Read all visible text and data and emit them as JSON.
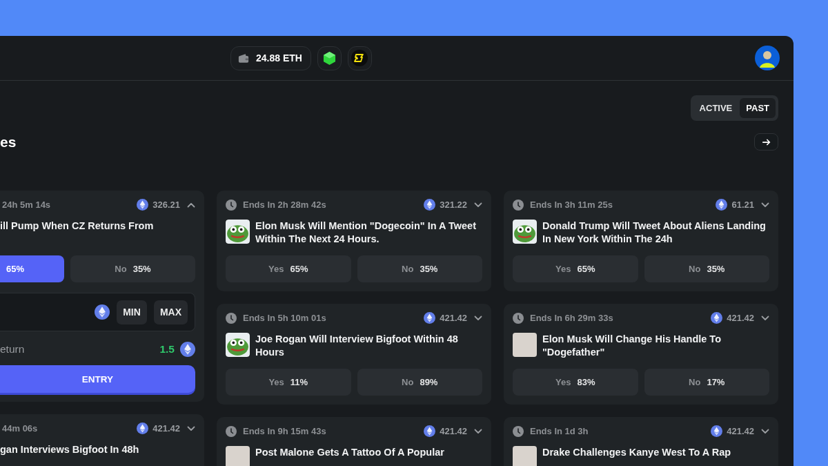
{
  "header": {
    "balance": "24.88 ETH"
  },
  "filter_tabs": [
    {
      "label": "ACTIVE",
      "selected": false
    },
    {
      "label": "PAST",
      "selected": true
    }
  ],
  "section": {
    "title": "es"
  },
  "columns": [
    {
      "cards": [
        {
          "clock": false,
          "ends": "24h 5m 14s",
          "amount": "326.21",
          "expanded": true,
          "question": "ill Pump When CZ Returns From",
          "options": [
            {
              "pct": "65%",
              "selected": true
            },
            {
              "label": "No",
              "pct": "35%",
              "selected": false
            }
          ],
          "bet": {
            "min": "MIN",
            "max": "MAX",
            "return_label": "eturn",
            "return_value": "1.5",
            "entry": "ENTRY"
          }
        },
        {
          "clock": false,
          "ends": "44m 06s",
          "amount": "421.42",
          "expanded": false,
          "question": "gan Interviews Bigfoot In 48h"
        }
      ]
    },
    {
      "cards": [
        {
          "clock": true,
          "ends": "Ends In 2h 28m 42s",
          "amount": "321.22",
          "expanded": false,
          "thumbnail": {
            "kind": "frog"
          },
          "question": "Elon Musk Will Mention \"Dogecoin\" In A Tweet Within The Next 24 Hours.",
          "options": [
            {
              "label": "Yes",
              "pct": "65%",
              "selected": false
            },
            {
              "label": "No",
              "pct": "35%",
              "selected": false
            }
          ]
        },
        {
          "clock": true,
          "ends": "Ends In 5h 10m 01s",
          "amount": "421.42",
          "expanded": false,
          "thumbnail": {
            "kind": "frog"
          },
          "question": "Joe Rogan Will Interview Bigfoot Within 48 Hours",
          "options": [
            {
              "label": "Yes",
              "pct": "11%",
              "selected": false
            },
            {
              "label": "No",
              "pct": "89%",
              "selected": false
            }
          ]
        },
        {
          "clock": true,
          "ends": "Ends In 9h 15m 43s",
          "amount": "421.42",
          "expanded": false,
          "thumbnail": {
            "kind": "photo"
          },
          "question": "Post Malone Gets A Tattoo Of A Popular"
        }
      ]
    },
    {
      "cards": [
        {
          "clock": true,
          "ends": "Ends In 3h 11m 25s",
          "amount": "61.21",
          "expanded": false,
          "thumbnail": {
            "kind": "frog"
          },
          "question": "Donald Trump Will Tweet About Aliens Landing In New York Within The 24h",
          "options": [
            {
              "label": "Yes",
              "pct": "65%",
              "selected": false
            },
            {
              "label": "No",
              "pct": "35%",
              "selected": false
            }
          ]
        },
        {
          "clock": true,
          "ends": "Ends In 6h 29m 33s",
          "amount": "421.42",
          "expanded": false,
          "thumbnail": {
            "kind": "photo"
          },
          "question": "Elon Musk Will Change His Handle To \"Dogefather\"",
          "options": [
            {
              "label": "Yes",
              "pct": "83%",
              "selected": false
            },
            {
              "label": "No",
              "pct": "17%",
              "selected": false
            }
          ]
        },
        {
          "clock": true,
          "ends": "Ends In 1d 3h",
          "amount": "421.42",
          "expanded": false,
          "thumbnail": {
            "kind": "photo"
          },
          "question": "Drake Challenges Kanye West To A Rap"
        }
      ]
    }
  ]
}
